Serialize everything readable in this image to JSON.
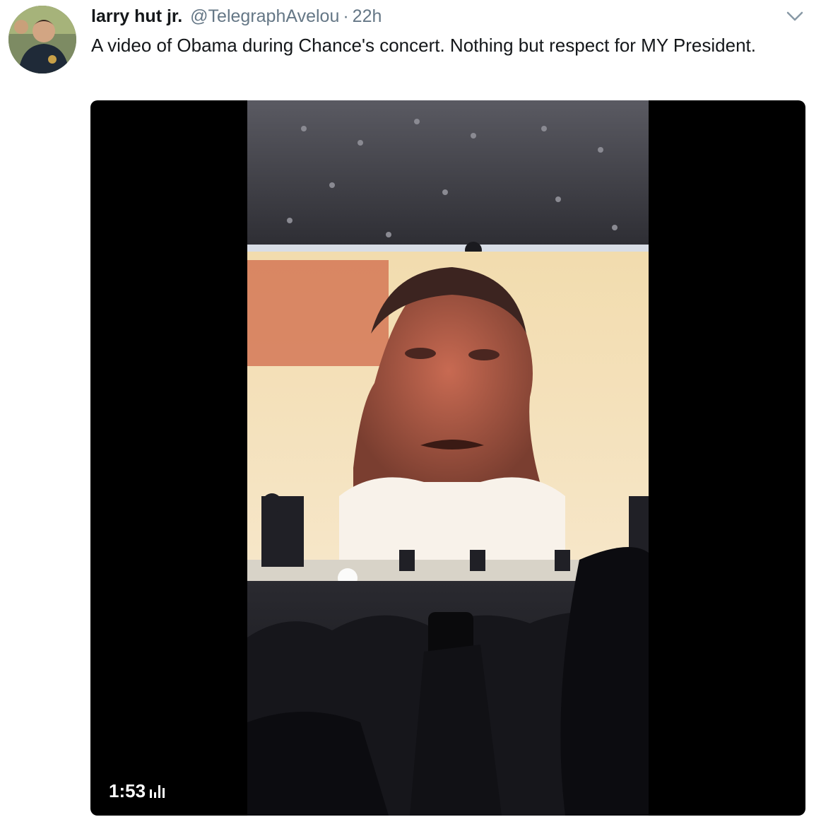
{
  "tweet": {
    "author_name": "larry hut jr.",
    "handle": "@TelegraphAvelou",
    "separator": "·",
    "time": "22h",
    "text": "A video of Obama during Chance's concert. Nothing but respect for MY President."
  },
  "media": {
    "duration": "1:53",
    "audio_icon": "audio-bars-icon"
  },
  "icons": {
    "caret": "chevron-down-icon",
    "avatar": "avatar"
  },
  "colors": {
    "text_primary": "#14171a",
    "text_secondary": "#657786",
    "media_background": "#000000"
  }
}
